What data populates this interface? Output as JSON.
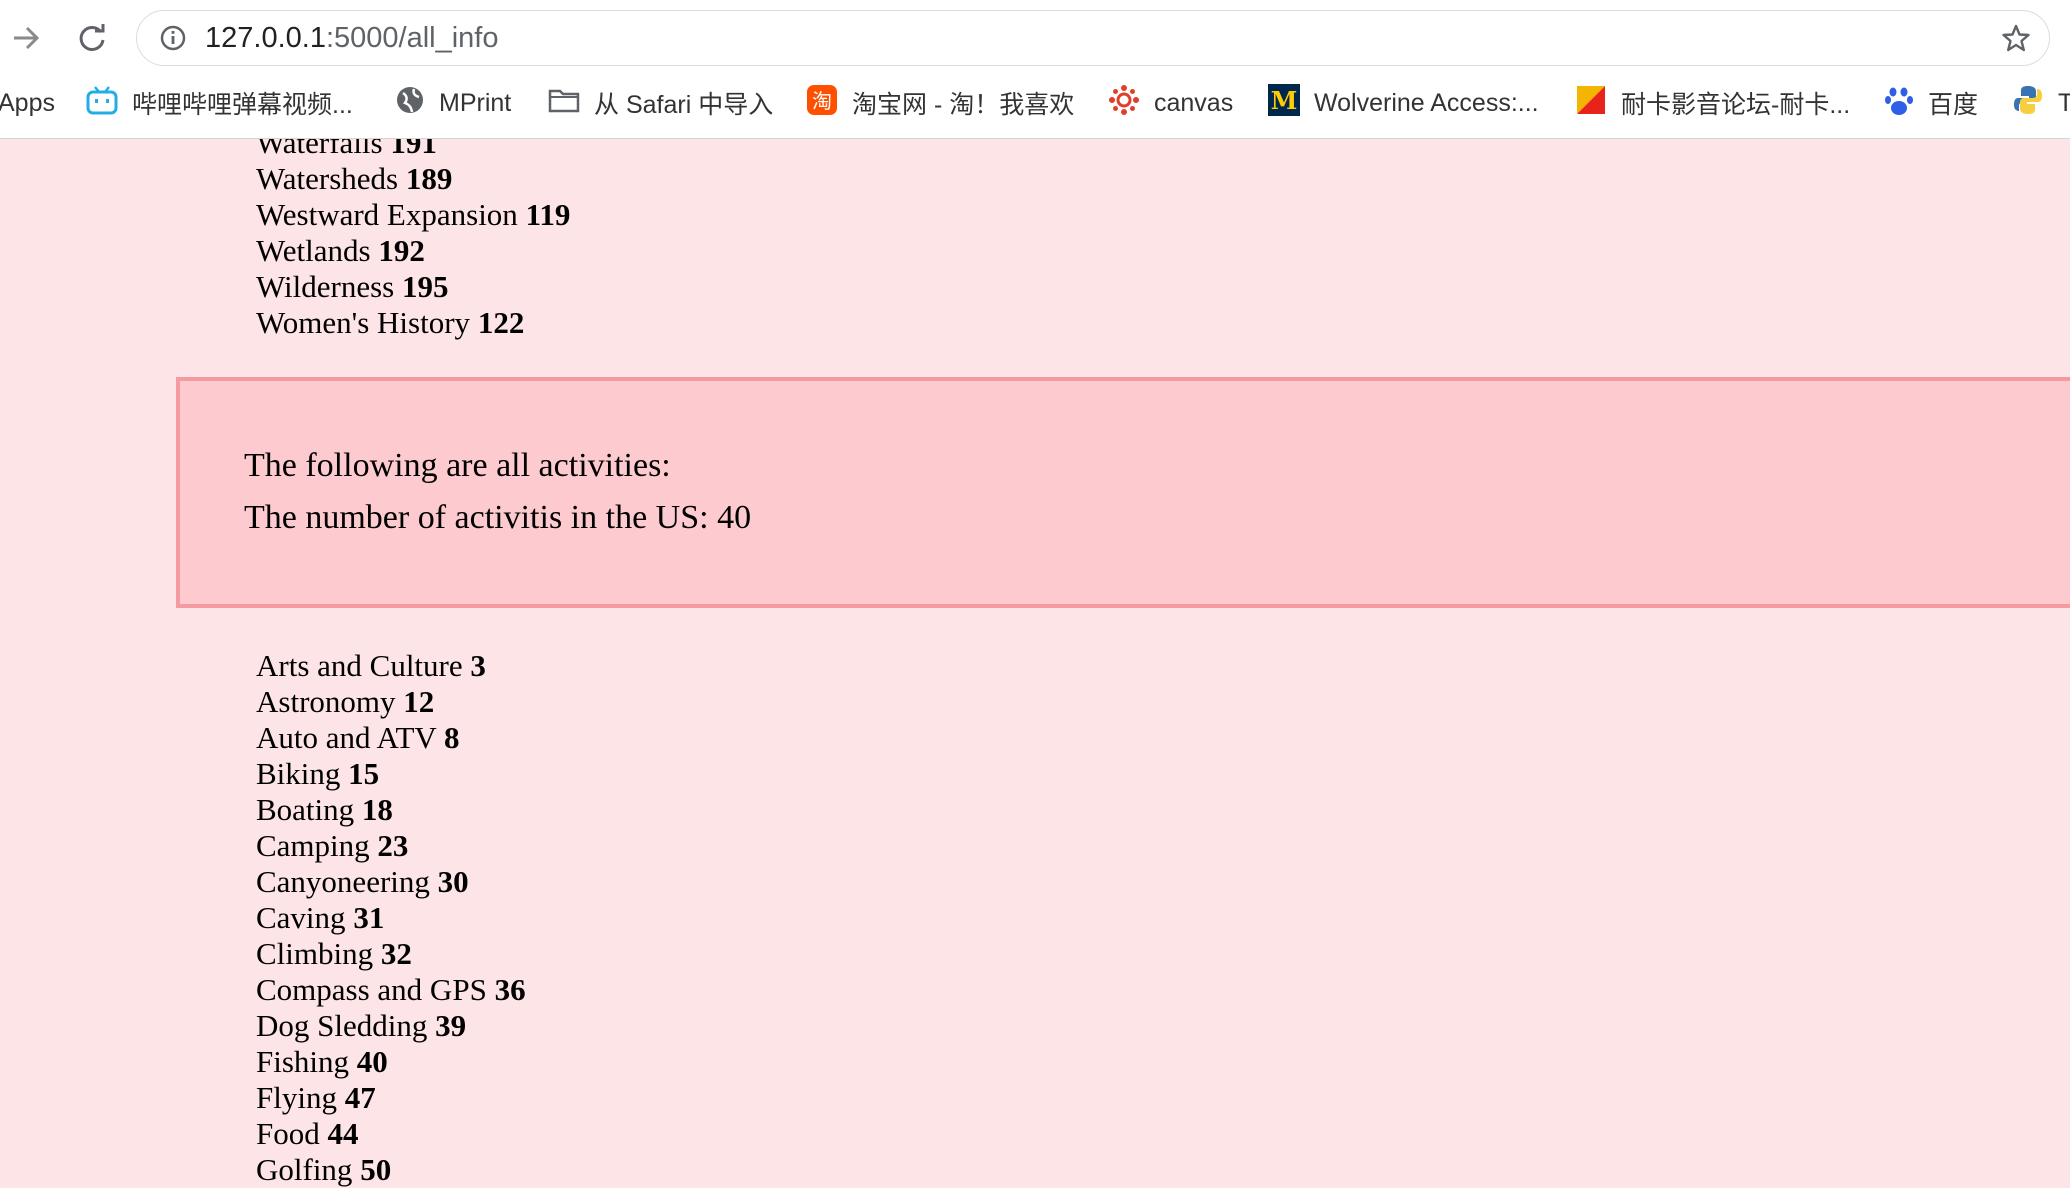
{
  "browser": {
    "url_host": "127.0.0.1",
    "url_rest": ":5000/all_info",
    "bookmarks": [
      {
        "label": "Apps",
        "icon": "apps-grid-icon"
      },
      {
        "label": "哔哩哔哩弹幕视频...",
        "icon": "bilibili-icon"
      },
      {
        "label": "MPrint",
        "icon": "globe-icon"
      },
      {
        "label": "从 Safari 中导入",
        "icon": "folder-icon"
      },
      {
        "label": "淘宝网 - 淘！我喜欢",
        "icon": "taobao-icon"
      },
      {
        "label": "canvas",
        "icon": "canvas-icon"
      },
      {
        "label": "Wolverine Access:...",
        "icon": "michigan-m-icon"
      },
      {
        "label": "耐卡影音论坛-耐卡...",
        "icon": "flag-icon"
      },
      {
        "label": "百度",
        "icon": "baidu-paw-icon"
      },
      {
        "label": "T",
        "icon": "python-icon"
      }
    ]
  },
  "topics_tail": [
    {
      "name": "Waterfalls",
      "count": "191"
    },
    {
      "name": "Watersheds",
      "count": "189"
    },
    {
      "name": "Westward Expansion",
      "count": "119"
    },
    {
      "name": "Wetlands",
      "count": "192"
    },
    {
      "name": "Wilderness",
      "count": "195"
    },
    {
      "name": "Women's History",
      "count": "122"
    }
  ],
  "activities_header": {
    "line1": "The following are all activities:",
    "line2": "The number of activitis in the US: 40"
  },
  "activities": [
    {
      "name": "Arts and Culture",
      "count": "3"
    },
    {
      "name": "Astronomy",
      "count": "12"
    },
    {
      "name": "Auto and ATV",
      "count": "8"
    },
    {
      "name": "Biking",
      "count": "15"
    },
    {
      "name": "Boating",
      "count": "18"
    },
    {
      "name": "Camping",
      "count": "23"
    },
    {
      "name": "Canyoneering",
      "count": "30"
    },
    {
      "name": "Caving",
      "count": "31"
    },
    {
      "name": "Climbing",
      "count": "32"
    },
    {
      "name": "Compass and GPS",
      "count": "36"
    },
    {
      "name": "Dog Sledding",
      "count": "39"
    },
    {
      "name": "Fishing",
      "count": "40"
    },
    {
      "name": "Flying",
      "count": "47"
    },
    {
      "name": "Food",
      "count": "44"
    },
    {
      "name": "Golfing",
      "count": "50"
    }
  ],
  "colors": {
    "page_background": "#fde4e6",
    "box_background": "#fdcbcf",
    "box_border": "#f59aa1"
  }
}
